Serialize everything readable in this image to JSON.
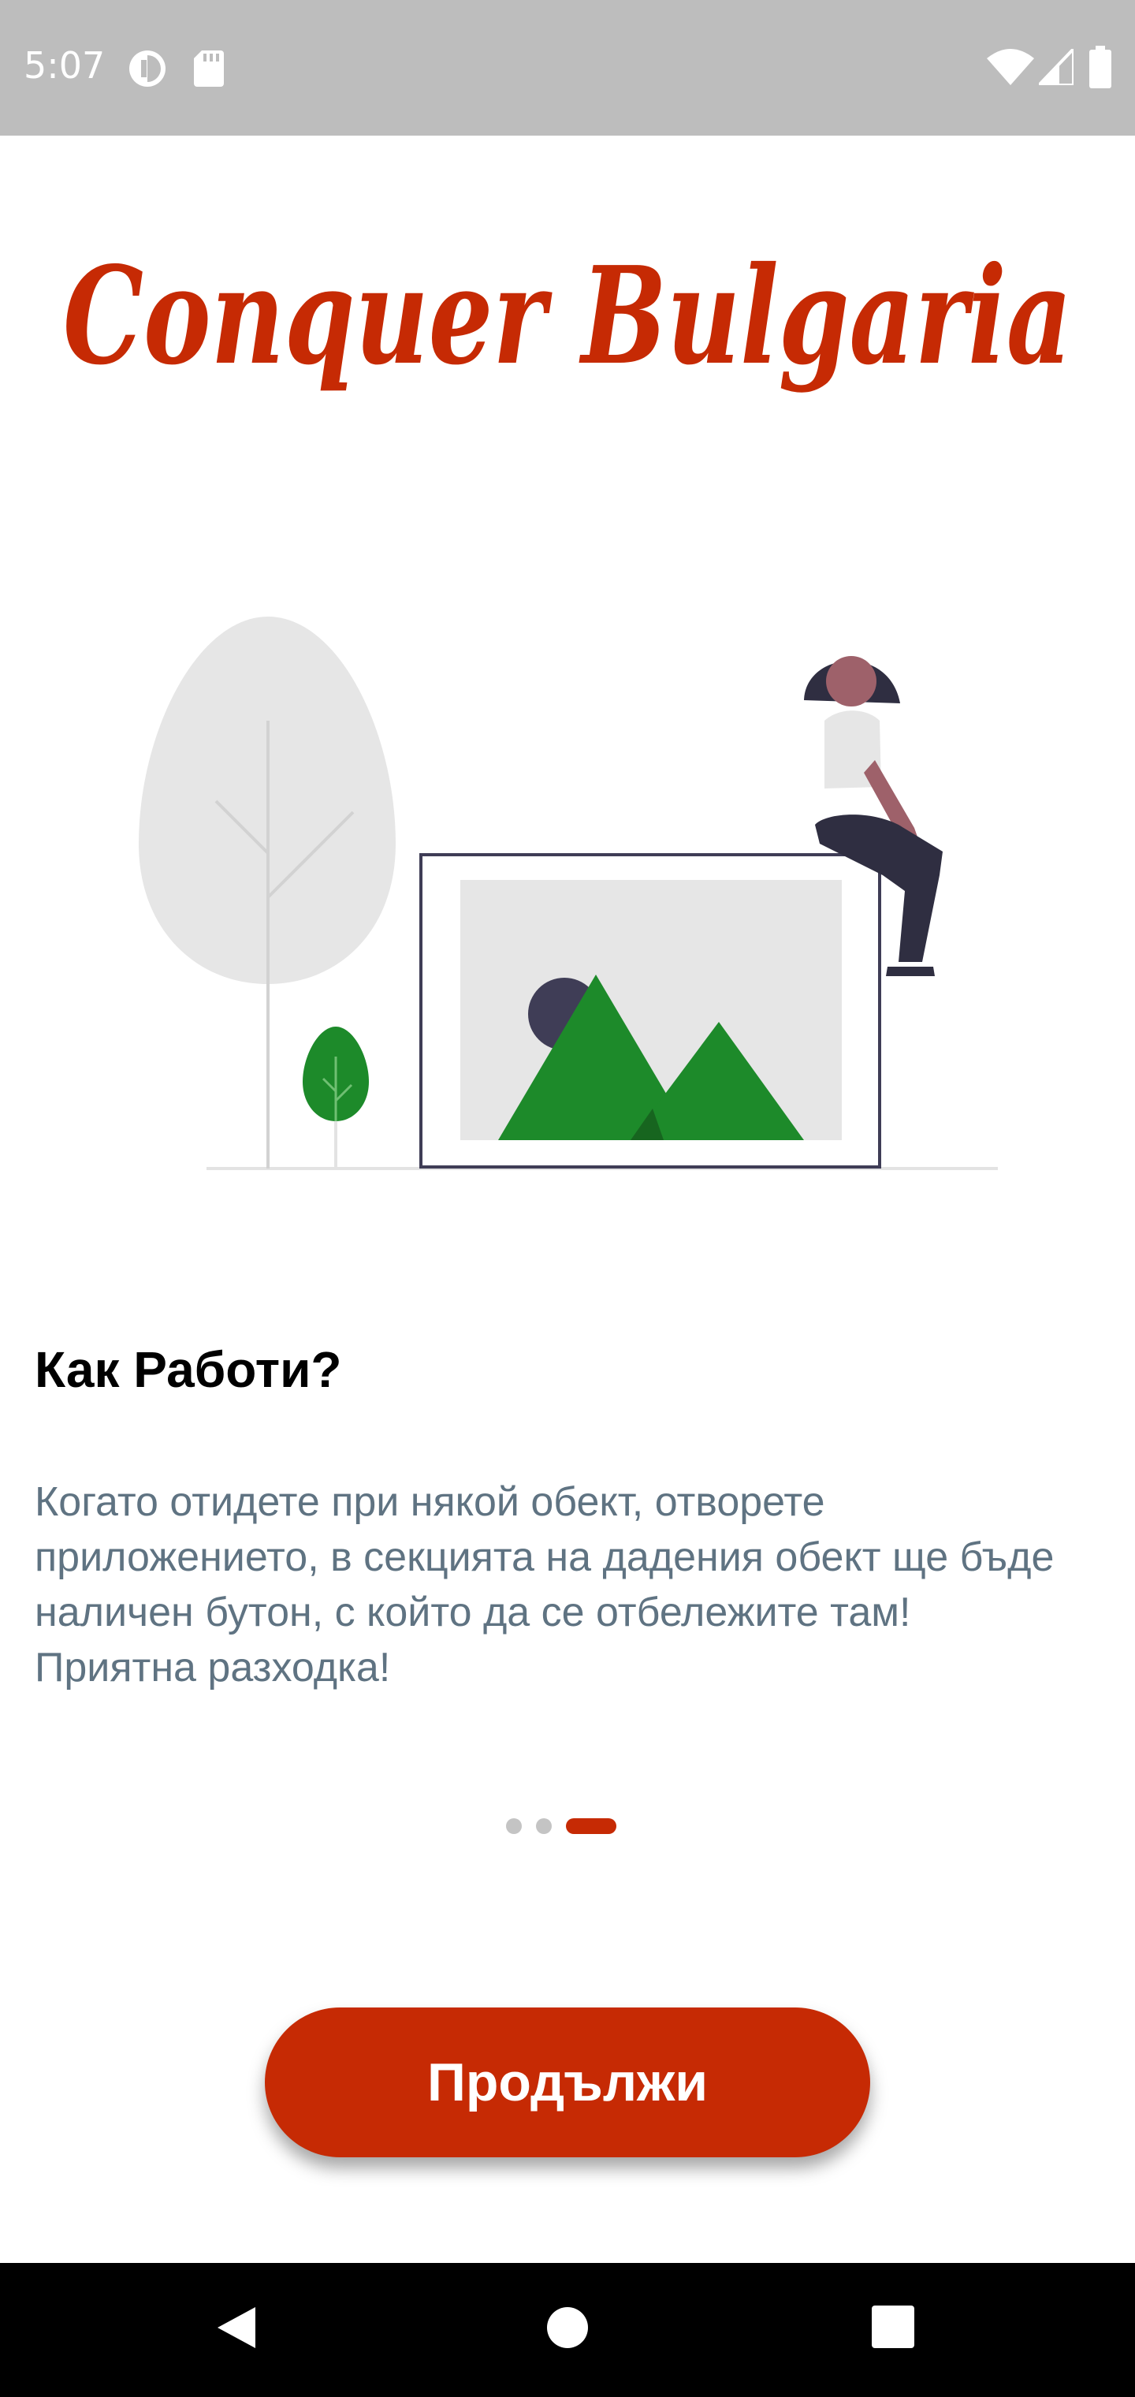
{
  "status_bar": {
    "time": "5:07",
    "icons_left": [
      "data-saver-icon",
      "sd-card-icon"
    ],
    "icons_right": [
      "wifi-icon",
      "cellular-signal-icon",
      "battery-icon"
    ]
  },
  "logo": {
    "text": "Conquer Bulgaria",
    "color": "#c62a04"
  },
  "illustration": {
    "description_icons": [
      "tree-icon",
      "small-tree-icon",
      "picture-frame-icon",
      "person-sitting-icon"
    ],
    "accent_color": "#1d8a2a"
  },
  "onboarding": {
    "title": "Как Работи?",
    "description": "Когато отидете при някой обект, отворете приложението, в секцията на дадения обект ще бъде наличен бутон, с който да се отбележите там! Приятна разходка!",
    "page_count": 3,
    "current_page": 3
  },
  "actions": {
    "continue_label": "Продължи",
    "button_color": "#c62a04"
  },
  "nav_bar": {
    "icons": [
      "back-icon",
      "home-icon",
      "recents-icon"
    ]
  }
}
